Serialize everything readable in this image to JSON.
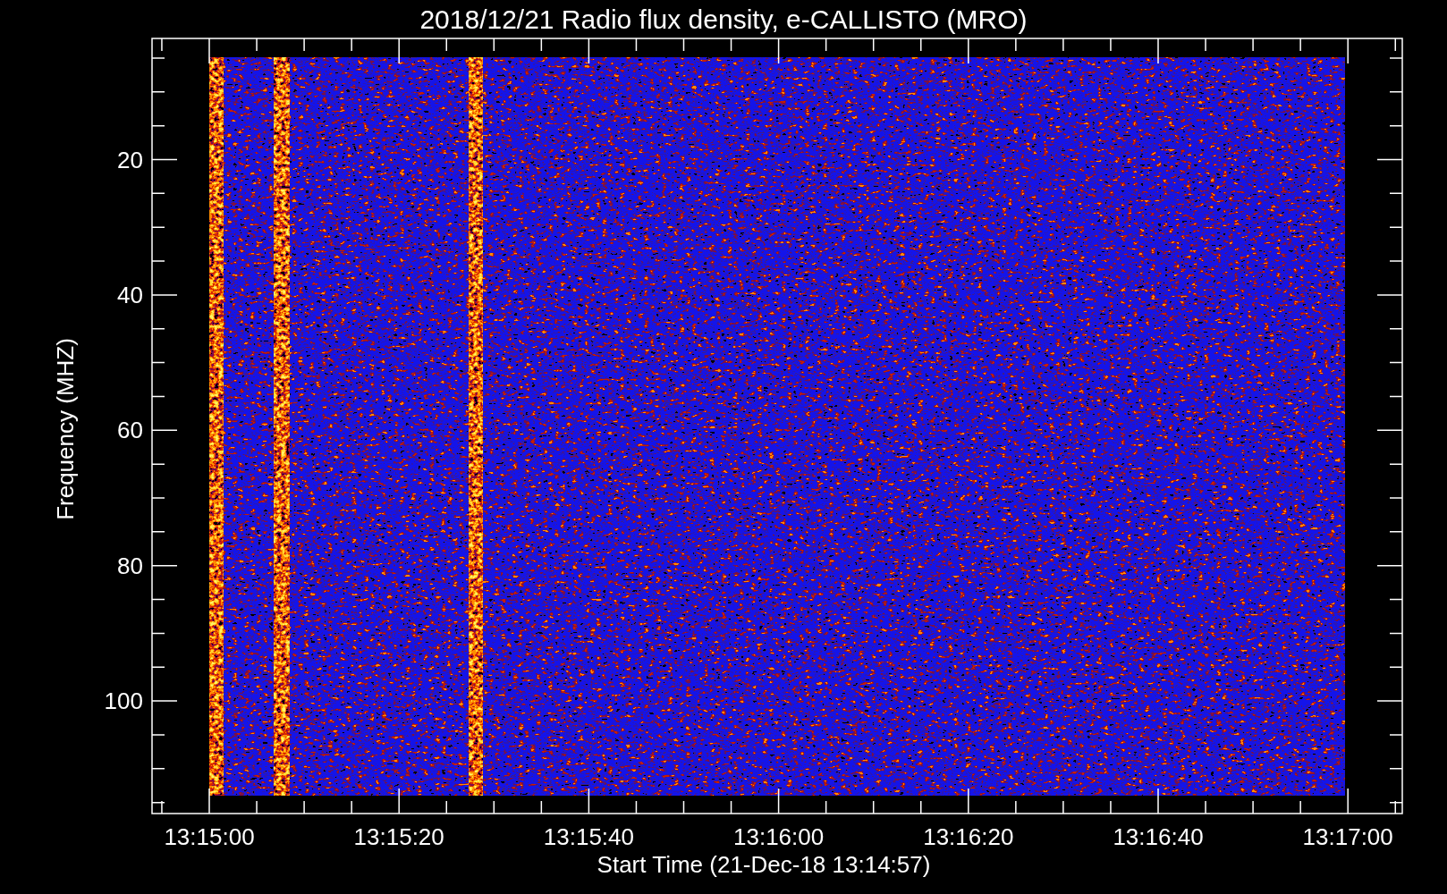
{
  "title": "2018/12/21  Radio flux density, e-CALLISTO (MRO)",
  "y_axis": {
    "label": "Frequency (MHZ)",
    "ticks": [
      "20",
      "40",
      "60",
      "80",
      "100"
    ]
  },
  "x_axis": {
    "label": "Start Time (21-Dec-18 13:14:57)",
    "ticks": [
      "13:15:00",
      "13:15:20",
      "13:15:40",
      "13:16:00",
      "13:16:20",
      "13:16:40",
      "13:17:00"
    ]
  }
}
